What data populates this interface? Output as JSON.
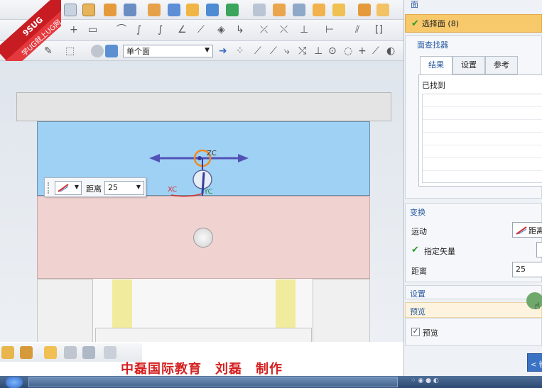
{
  "logo": {
    "line1": "9SUG",
    "line2": "学UG就上UG网"
  },
  "toolbar": {
    "face_rule_value": "单个面",
    "face_rule_options": [
      "单个面"
    ]
  },
  "viewport": {
    "handle_labels": {
      "zc": "ZC",
      "xc": "XC",
      "yc": "YC"
    },
    "onscreen_input": {
      "label": "距离",
      "value": "25"
    }
  },
  "bottom_caption": "中磊国际教育　刘磊　制作",
  "panel": {
    "header_face": "面",
    "select_face_label": "选择面 (8)",
    "face_finder_title": "面查找器",
    "tabs": [
      "结果",
      "设置",
      "参考"
    ],
    "found_label": "已找到",
    "transform_title": "变换",
    "motion_label": "运动",
    "motion_value": "距离",
    "vector_label": "指定矢量",
    "distance_label": "距离",
    "distance_value": "25",
    "settings_title": "设置",
    "preview_title": "预览",
    "preview_checkbox_label": "预览",
    "back_button": "< 後"
  },
  "colors": {
    "blue_plate": "#9fd1f5",
    "pink_plate": "#f0d3d1",
    "selected_bar": "#f7c96b",
    "caption_red": "#d42020",
    "accent_orange": "#f08a20"
  }
}
